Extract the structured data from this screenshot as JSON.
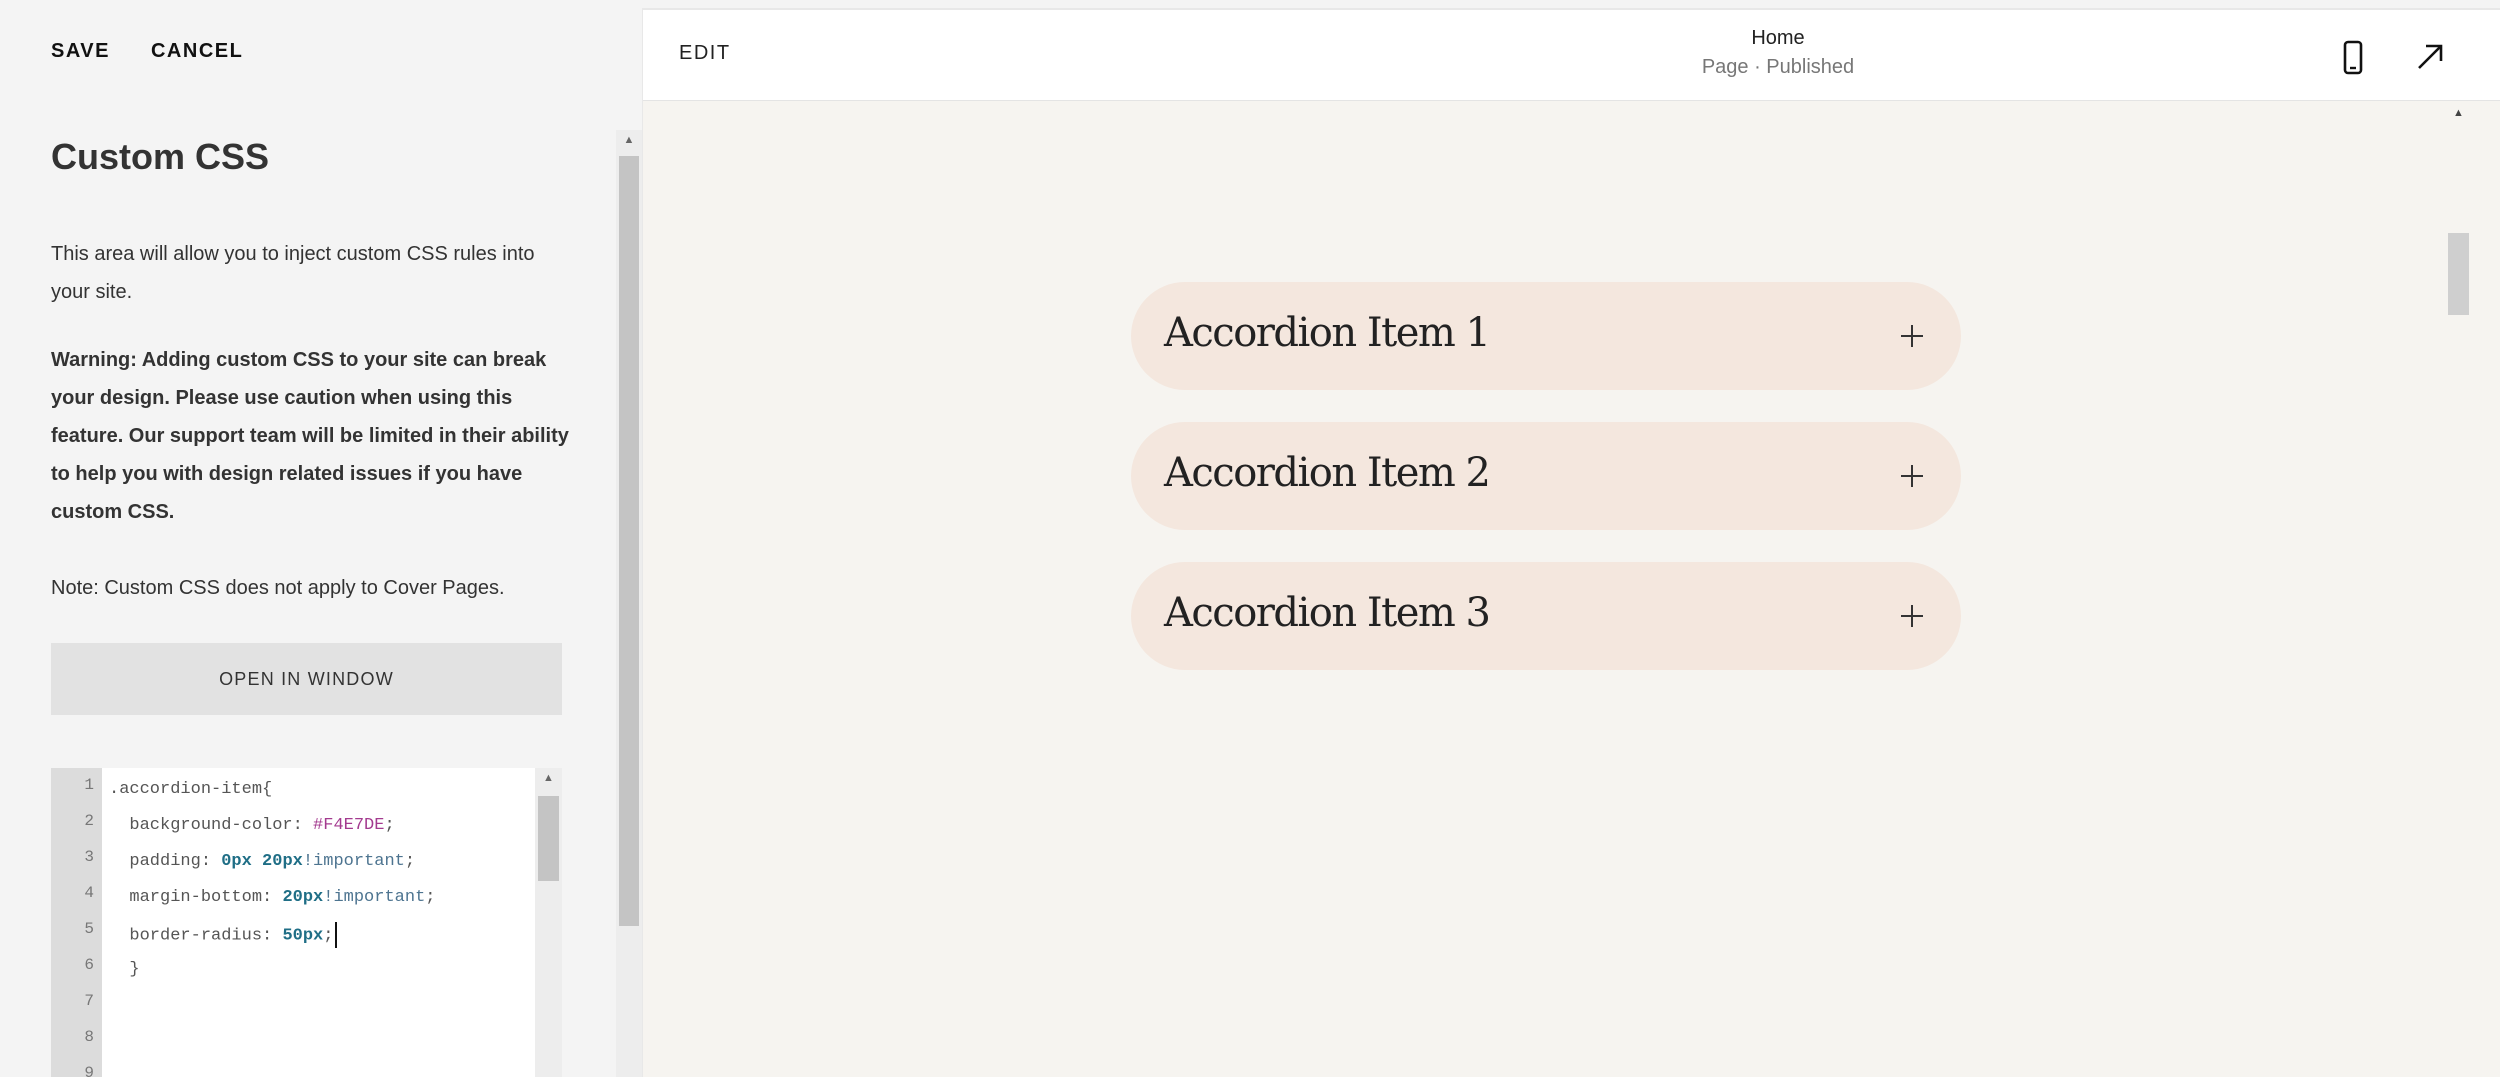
{
  "toolbar": {
    "save_label": "SAVE",
    "cancel_label": "CANCEL"
  },
  "panel": {
    "title": "Custom CSS",
    "intro": "This area will allow you to inject custom CSS rules into your site.",
    "warning": "Warning: Adding custom CSS to your site can break your design. Please use caution when using this feature. Our support team will be limited in their ability to help you with design related issues if you have custom CSS.",
    "note": "Note: Custom CSS does not apply to Cover Pages.",
    "open_window_label": "OPEN IN WINDOW"
  },
  "editor": {
    "line_numbers": [
      "1",
      "2",
      "3",
      "4",
      "5",
      "6",
      "7",
      "8",
      "9"
    ],
    "code": {
      "l1": ".accordion-item{",
      "l2_prop": "background-color: ",
      "l2_val": "#F4E7DE",
      "l3_prop": "padding: ",
      "l3_val": "0px 20px",
      "l3_imp": "!important",
      "l4_prop": "margin-bottom: ",
      "l4_val": "20px",
      "l4_imp": "!important",
      "l5_prop": "border-radius: ",
      "l5_val": "50px",
      "l6": "}"
    }
  },
  "preview": {
    "edit_label": "EDIT",
    "page_title": "Home",
    "page_status": "Page · Published",
    "accordion_items": [
      "Accordion Item 1",
      "Accordion Item 2",
      "Accordion Item 3"
    ],
    "accordion_bg": "#F4E7DE"
  },
  "icons": {
    "mobile": "mobile-phone-icon",
    "open": "arrow-up-right-icon",
    "expand": "plus-icon"
  }
}
